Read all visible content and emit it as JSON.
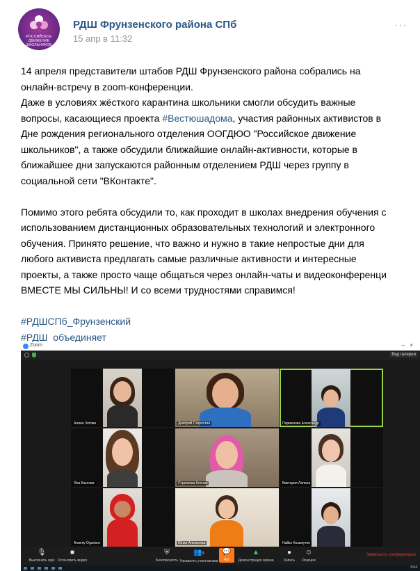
{
  "post": {
    "author": "РДШ Фрунзенского района СПб",
    "date": "15 апр в 11:32",
    "more": "···",
    "avatar_text": "РОССИЙСКОЕ ДВИЖЕНИЕ ШКОЛЬНИКОВ",
    "lines": [
      "14 апреля представители штабов РДШ Фрунзенского района собрались на",
      "онлайн-встречу в zoom-конференции.",
      "Даже в условиях жёсткого карантина школьники смогли обсудить важные",
      "вопросы, касающиеся проекта ",
      "Дне рождения регионального отделения ОOГДЮО \"Российское движение",
      "школьников\", а также обсудили ближайшие онлайн-активности, которые в",
      "ближайшее дни запускаются районным отделением РДШ через группу в",
      "социальной сети \"ВКонтакте\".",
      "Помимо этого ребята обсудили то, как проходит в школах внедрения обучения с",
      "использованием дистанционных образовательных технологий и электронного",
      "обучения. Принято решение, что важно и нужно в такие непростые дни для",
      "любого активиста предлагать самые различные активности и интересные",
      "проекты, а также просто чаще общаться через онлайн-чаты и видеоконференци",
      "ВМЕСТЕ МЫ СИЛЬНЫ! И со всеми трудностями справимся!"
    ],
    "inline_hashtag": "#Вестюшадома",
    "line4_tail": ", участия районных активистов в",
    "hashtags": [
      "#РДШСПб_Фрунзенский",
      "#РДШ_объединяет"
    ]
  },
  "zoom": {
    "title": "Zoom",
    "view_button": "Вид галереи",
    "accent_active": "#9bd34a",
    "participants": [
      {
        "name": "Алина Зотова"
      },
      {
        "name": "Дмитрий Старостин"
      },
      {
        "name": "Парменова Александр"
      },
      {
        "name": "Яна Козлова"
      },
      {
        "name": "Стрелкова Ксения"
      },
      {
        "name": "Виктория Лапина"
      },
      {
        "name": "Arseniy Ogurtsov"
      },
      {
        "name": "Юлия Алексеева"
      },
      {
        "name": "Найкл Козьмутян"
      }
    ],
    "toolbar": {
      "mute": "Выключить звук",
      "video": "Остановить видео",
      "security": "Безопасность",
      "participants": "Управлять участниками",
      "participants_count": "9",
      "chat": "Чат",
      "share": "Демонстрация экрана",
      "record": "Запись",
      "reactions": "Реакции",
      "end": "Завершить конференцию"
    },
    "clock": "9:54"
  }
}
